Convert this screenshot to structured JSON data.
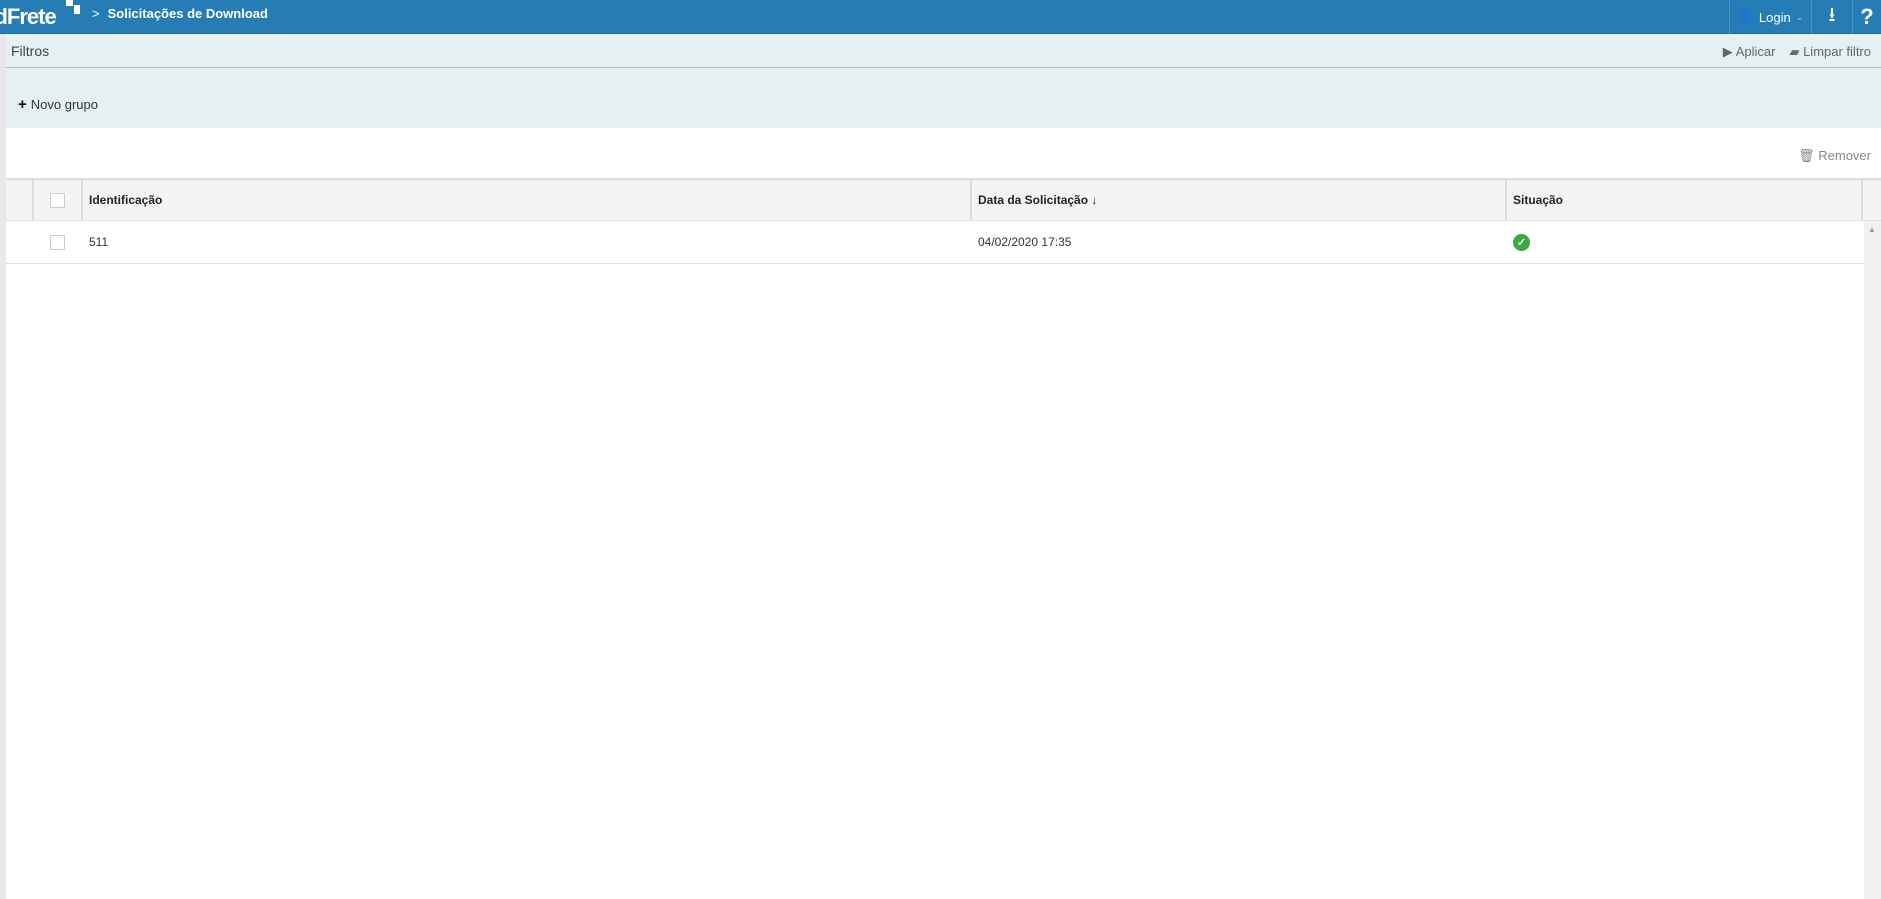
{
  "header": {
    "logo": "AddFrete",
    "breadcrumb": "Solicitações de Download",
    "login": "Login",
    "icons": {
      "user": "user-icon",
      "download": "download-icon",
      "help": "help-icon"
    }
  },
  "filters": {
    "title": "Filtros",
    "apply": "Aplicar",
    "clear": "Limpar filtro",
    "new_group": "Novo grupo"
  },
  "toolbar": {
    "remove": "Remover"
  },
  "table": {
    "columns": [
      "Identificação",
      "Data da Solicitação ↓",
      "Situação"
    ],
    "rows": [
      {
        "id": "511",
        "date": "04/02/2020 17:35",
        "status": "success"
      }
    ]
  },
  "colors": {
    "brand": "#267db5",
    "success": "#3aa845",
    "filter_bg": "#e5f0f2"
  }
}
